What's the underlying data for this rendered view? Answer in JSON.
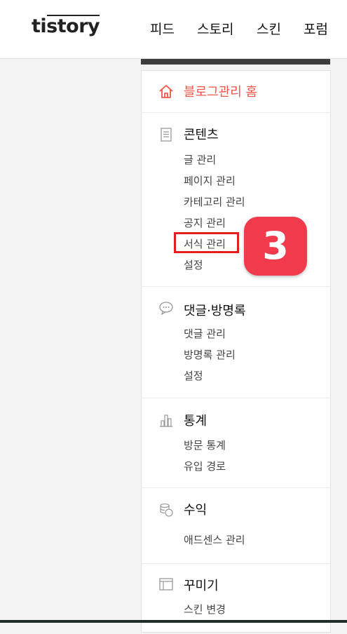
{
  "header": {
    "logo_ti": "ti",
    "logo_story": "story",
    "nav": [
      "피드",
      "스토리",
      "스킨",
      "포럼"
    ]
  },
  "sidebar": {
    "home": {
      "label": "블로그관리 홈",
      "icon": "home-icon"
    },
    "sections": [
      {
        "title": "콘텐츠",
        "icon": "document-icon",
        "items": [
          "글 관리",
          "페이지 관리",
          "카테고리 관리",
          "공지 관리",
          "서식 관리",
          "설정"
        ]
      },
      {
        "title": "댓글·방명록",
        "icon": "comment-icon",
        "items": [
          "댓글 관리",
          "방명록 관리",
          "설정"
        ]
      },
      {
        "title": "통계",
        "icon": "bar-chart-icon",
        "items": [
          "방문 통계",
          "유입 경로"
        ]
      },
      {
        "title": "수익",
        "icon": "coins-icon",
        "items": [
          "애드센스 관리"
        ]
      },
      {
        "title": "꾸미기",
        "icon": "layout-icon",
        "items": [
          "스킨 변경"
        ]
      }
    ]
  },
  "annotation": {
    "step_number": "3",
    "highlight_color": "#e41e1e",
    "badge_color": "#f23a4d"
  },
  "colors": {
    "accent": "#f05648"
  }
}
